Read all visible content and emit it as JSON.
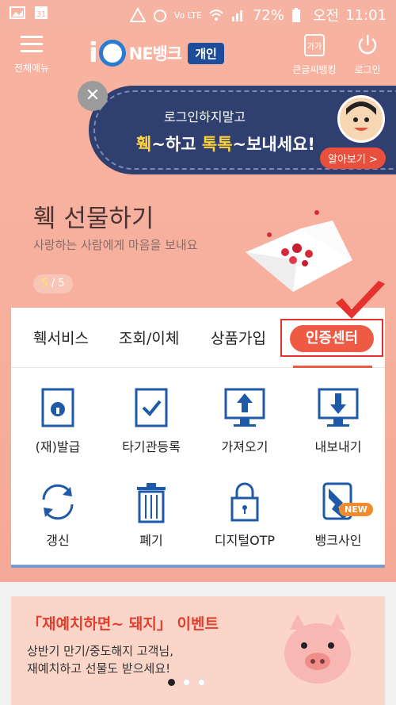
{
  "statusbar": {
    "battery": "72%",
    "ampm": "오전",
    "time": "11:01",
    "network": "Vo LTE"
  },
  "header": {
    "menu_label": "전체메뉴",
    "logo_text": "NE뱅크",
    "logo_badge": "개인",
    "bigfont_label": "큰글씨뱅킹",
    "logout_label": "로그인"
  },
  "ad": {
    "line1": "로그인하지말고",
    "line2_a": "훽",
    "line2_b": "~하고 ",
    "line2_c": "톡톡",
    "line2_d": "~보내세요!",
    "more_label": "알아보기 >"
  },
  "gift": {
    "title": "훽 선물하기",
    "subtitle": "사랑하는 사람에게 마음을 보내요",
    "page_current": "5",
    "page_total": "/ 5"
  },
  "tabs": [
    {
      "label": "훽서비스"
    },
    {
      "label": "조회/이체"
    },
    {
      "label": "상품가입"
    },
    {
      "label": "인증센터"
    }
  ],
  "grid": [
    {
      "label": "(재)발급",
      "icon": "lock-icon"
    },
    {
      "label": "타기관등록",
      "icon": "check-box-icon"
    },
    {
      "label": "가져오기",
      "icon": "monitor-upload-icon"
    },
    {
      "label": "내보내기",
      "icon": "monitor-download-icon"
    },
    {
      "label": "갱신",
      "icon": "refresh-icon"
    },
    {
      "label": "폐기",
      "icon": "trash-icon"
    },
    {
      "label": "디지털OTP",
      "icon": "padlock-icon"
    },
    {
      "label": "뱅크사인",
      "icon": "banksign-icon",
      "badge": "NEW"
    }
  ],
  "event": {
    "title": "「재예치하면~ 돼지」 이벤트",
    "desc_line1": "상반기 만기/중도해지 고객님,",
    "desc_line2": "재예치하고 선물도 받으세요!"
  },
  "colors": {
    "bg_peach": "#f8b2a0",
    "accent_red": "#e5322e",
    "brand_blue": "#1d4c9a",
    "icon_blue": "#1e5aa8"
  }
}
